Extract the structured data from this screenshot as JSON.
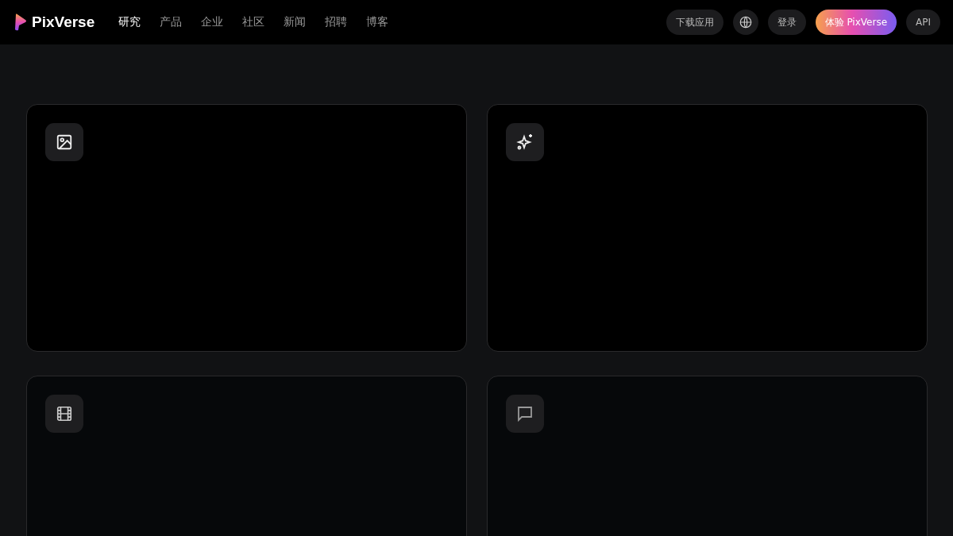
{
  "header": {
    "logo_text": "PixVerse",
    "nav": [
      {
        "label": "研究",
        "selected": true
      },
      {
        "label": "产品",
        "selected": false
      },
      {
        "label": "企业",
        "selected": false
      },
      {
        "label": "社区",
        "selected": false
      },
      {
        "label": "新闻",
        "selected": false
      },
      {
        "label": "招聘",
        "selected": false
      },
      {
        "label": "博客",
        "selected": false
      }
    ],
    "download_button": "下载应用",
    "login_button": "登录",
    "try_button": "体验 PixVerse",
    "api_button": "API"
  },
  "cards": [
    {
      "kind": "image"
    },
    {
      "kind": "sparkle"
    },
    {
      "kind": "film"
    },
    {
      "kind": "chat"
    }
  ]
}
